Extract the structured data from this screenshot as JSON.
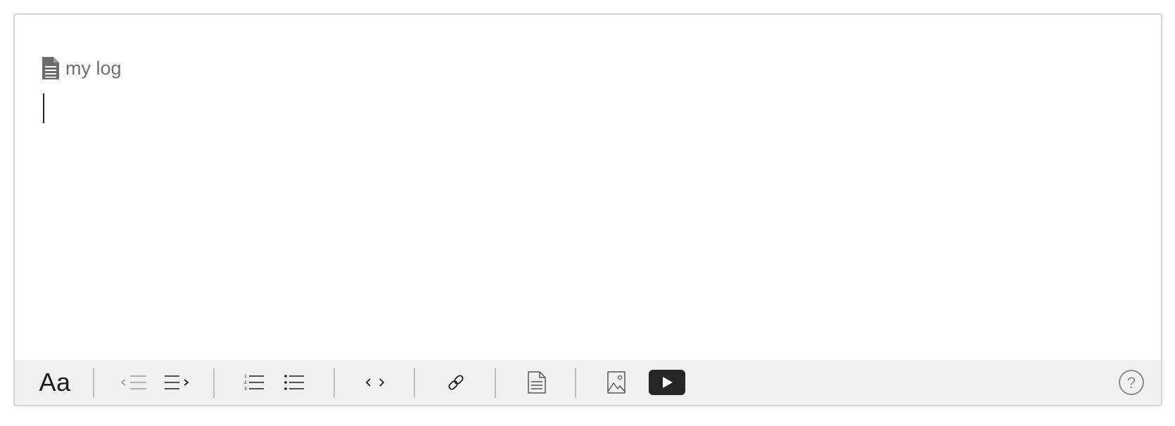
{
  "document": {
    "title": "my log",
    "body_text": ""
  },
  "toolbar": {
    "text_style_label": "Aa",
    "buttons": [
      {
        "icon": "text-style-icon"
      },
      {
        "icon": "outdent-icon"
      },
      {
        "icon": "indent-icon"
      },
      {
        "icon": "numbered-list-icon"
      },
      {
        "icon": "bulleted-list-icon"
      },
      {
        "icon": "code-icon"
      },
      {
        "icon": "link-icon"
      },
      {
        "icon": "document-icon"
      },
      {
        "icon": "image-icon"
      },
      {
        "icon": "video-icon"
      },
      {
        "icon": "help-icon"
      }
    ],
    "help_label": "?"
  },
  "colors": {
    "toolbar_bg": "#f1f1f1",
    "icon_dark": "#1c1c1c",
    "icon_disabled": "#9a9a9a",
    "border": "#d3d3d3",
    "video_button": "#262626"
  }
}
